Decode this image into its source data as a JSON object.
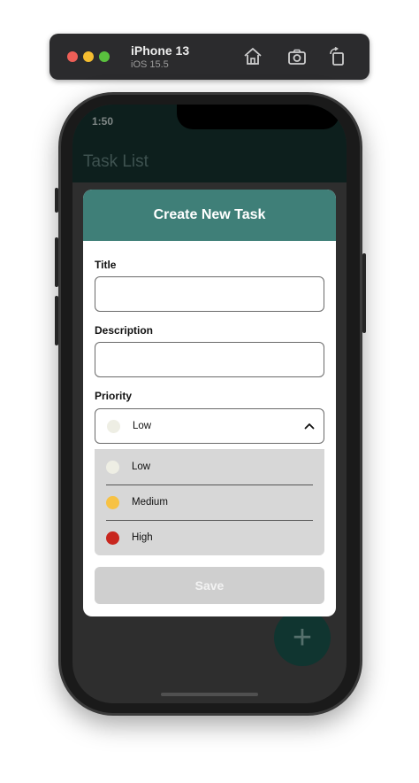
{
  "simulator": {
    "device_name": "iPhone 13",
    "os_version": "iOS 15.5",
    "icons": [
      "home-icon",
      "screenshot-icon",
      "rotate-icon"
    ]
  },
  "status_bar": {
    "time": "1:50",
    "icons": [
      "location-icon",
      "wifi-icon",
      "battery-icon"
    ]
  },
  "app": {
    "nav_title": "Task List",
    "fab_label": "+"
  },
  "modal": {
    "title": "Create New Task",
    "fields": {
      "title_label": "Title",
      "title_value": "",
      "description_label": "Description",
      "description_value": "",
      "priority_label": "Priority"
    },
    "priority_select": {
      "selected": "Low",
      "selected_color": "#eeeee4",
      "expanded": true,
      "options": [
        {
          "label": "Low",
          "color": "#eeeee4"
        },
        {
          "label": "Medium",
          "color": "#f7c244"
        },
        {
          "label": "High",
          "color": "#c8261e"
        }
      ]
    },
    "save_label": "Save"
  },
  "colors": {
    "header": "#3f7f78",
    "fab": "#103530",
    "save_disabled": "#cfcfcf"
  }
}
